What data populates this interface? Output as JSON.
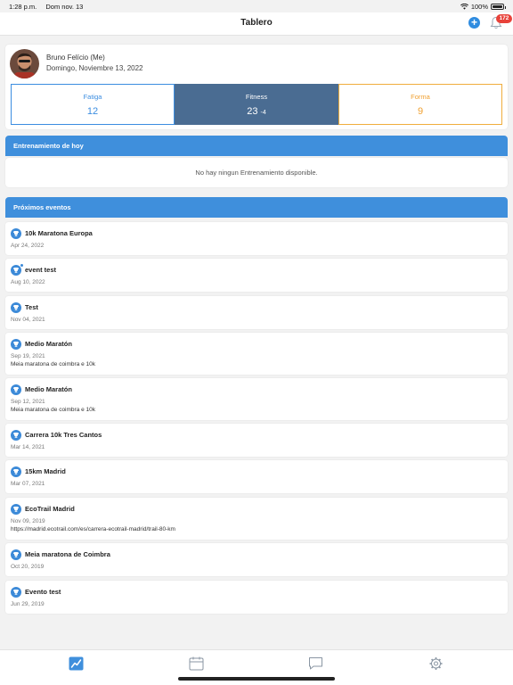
{
  "status": {
    "time": "1:28 p.m.",
    "date": "Dom nov. 13",
    "battery": "100%"
  },
  "nav": {
    "title": "Tablero",
    "notification_count": "172"
  },
  "profile": {
    "name": "Bruno Felício (Me)",
    "date": "Domingo, Noviembre 13, 2022"
  },
  "metrics": {
    "fatigue": {
      "label": "Fatiga",
      "value": "12"
    },
    "fitness": {
      "label": "Fitness",
      "value": "23",
      "delta": "-4"
    },
    "form": {
      "label": "Forma",
      "value": "9"
    }
  },
  "today": {
    "header": "Entrenamiento de hoy",
    "empty_text": "No hay ningun Entrenamiento disponible."
  },
  "upcoming": {
    "header": "Próximos eventos",
    "events": [
      {
        "title": "10k Maratona Europa",
        "date": "Apr 24, 2022",
        "desc": ""
      },
      {
        "title": "event test",
        "date": "Aug 10, 2022",
        "desc": ""
      },
      {
        "title": "Test",
        "date": "Nov 04, 2021",
        "desc": ""
      },
      {
        "title": "Medio Maratón",
        "date": "Sep 19, 2021",
        "desc": "Meia maratona de coimbra e 10k"
      },
      {
        "title": "Medio Maratón",
        "date": "Sep 12, 2021",
        "desc": "Meia maratona de coimbra e 10k"
      },
      {
        "title": "Carrera 10k Tres Cantos",
        "date": "Mar 14, 2021",
        "desc": ""
      },
      {
        "title": "15km Madrid",
        "date": "Mar 07, 2021",
        "desc": ""
      },
      {
        "title": "EcoTrail Madrid",
        "date": "Nov 09, 2019",
        "desc": "https://madrid.ecotrail.com/es/carrera-ecotrail-madrid/trail-80-km"
      },
      {
        "title": "Meia maratona de Coimbra",
        "date": "Oct 20, 2019",
        "desc": ""
      },
      {
        "title": "Evento test",
        "date": "Jun 29, 2019",
        "desc": ""
      }
    ]
  },
  "tabs": [
    {
      "icon": "trend-chart-icon",
      "active": true
    },
    {
      "icon": "calendar-icon",
      "active": false
    },
    {
      "icon": "chat-icon",
      "active": false
    },
    {
      "icon": "gear-icon",
      "active": false
    }
  ],
  "colors": {
    "accent": "#3f8fdc",
    "fitness_bg": "#4a6c92",
    "form": "#f0a030",
    "badge": "#e8423a"
  }
}
